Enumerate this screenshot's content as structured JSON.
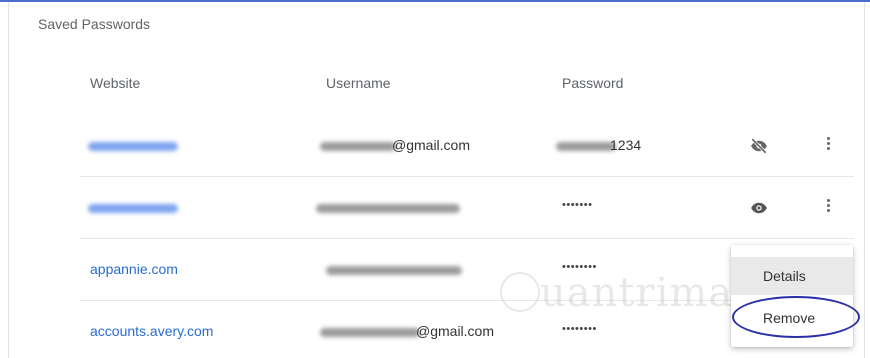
{
  "section": {
    "title": "Saved Passwords"
  },
  "columns": {
    "website": "Website",
    "username": "Username",
    "password": "Password"
  },
  "rows": [
    {
      "website": "",
      "username": "@gmail.com",
      "password": "1234",
      "visibility_icon": "eye-off-icon"
    },
    {
      "website": "",
      "username": "",
      "password": "•••••••",
      "visibility_icon": "eye-icon"
    },
    {
      "website": "appannie.com",
      "username": "",
      "password": "••••••••"
    },
    {
      "website": "accounts.avery.com",
      "username": "@gmail.com",
      "password": "••••••••"
    }
  ],
  "menu": {
    "details": "Details",
    "remove": "Remove"
  },
  "watermark": "uantrimang",
  "colors": {
    "link": "#2a6bd4",
    "accent": "#4a6fd0",
    "highlight": "#2b2fa8"
  }
}
